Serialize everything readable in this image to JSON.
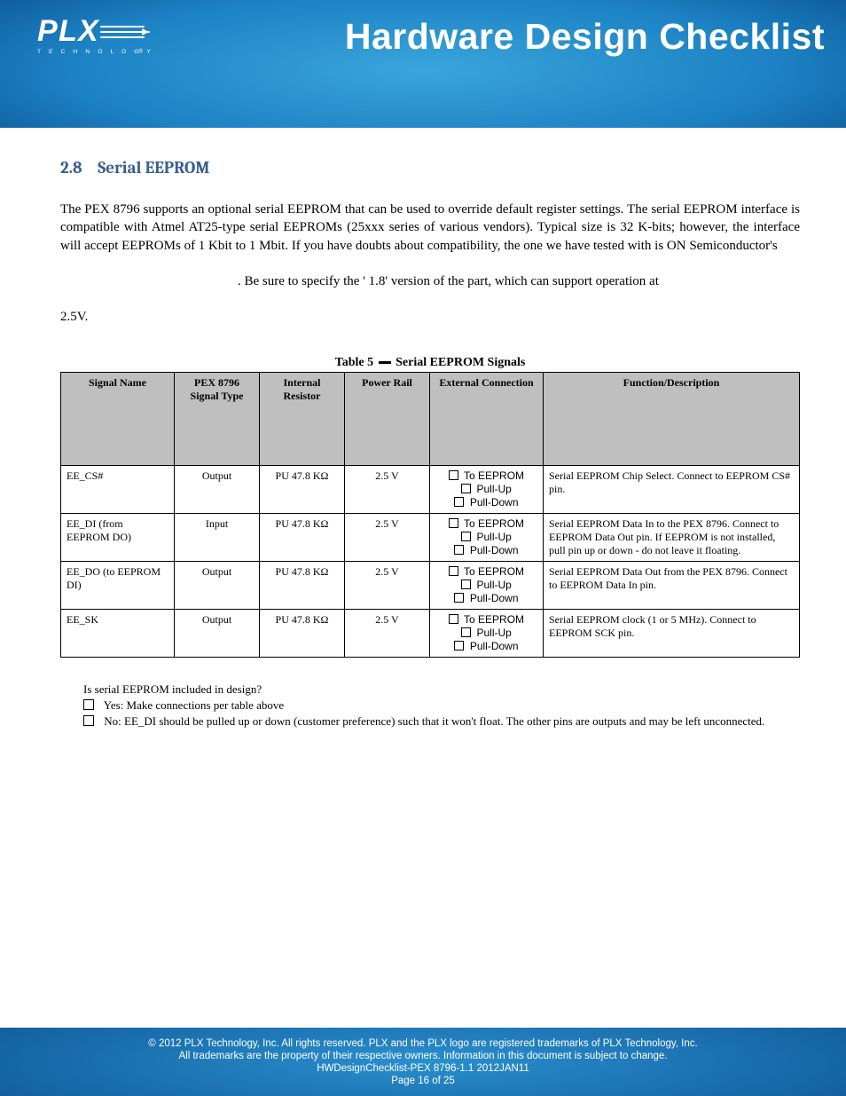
{
  "banner": {
    "title": "Hardware Design Checklist",
    "logo_alt": "PLX Technology"
  },
  "section": {
    "number": "2.8",
    "title": "Serial EEPROM"
  },
  "intro_line1": "The PEX 8796 supports an optional serial EEPROM that can be used to override default register settings. The serial EEPROM interface is compatible with Atmel AT25-type serial EEPROMs (25xxx series of various vendors). Typical size is 32 K-bits; however, the interface will accept EEPROMs of 1 Kbit to 1 Mbit. If you have doubts about compatibility, the one we have tested with is ON Semiconductor's",
  "intro_line2": ". Be sure to specify the ' 1.8' version of the part, which can support operation at",
  "intro_line3": "2.5V.",
  "table_caption_pre": "Table 5",
  "table_caption_post": "Serial EEPROM Signals",
  "columns": {
    "signal": "Signal Name",
    "type": "PEX 8796 Signal Type",
    "int": "Internal Resistor",
    "rail": "Power Rail",
    "conn": "External Connection",
    "func": "Function/Description"
  },
  "chk_options": [
    "To EEPROM",
    "Pull-Up",
    "Pull-Down"
  ],
  "rows": [
    {
      "signal": "EE_CS#",
      "type": "Output",
      "int": "PU 47.8 KΩ",
      "rail": "2.5 V",
      "func": "Serial EEPROM Chip Select. Connect to EEPROM CS# pin."
    },
    {
      "signal": "EE_DI (from EEPROM DO)",
      "type": "Input",
      "int": "PU 47.8 KΩ",
      "rail": "2.5 V",
      "func": "Serial EEPROM Data In to the PEX 8796. Connect to EEPROM Data Out pin. If EEPROM is not installed, pull pin up or down - do not leave it floating."
    },
    {
      "signal": "EE_DO (to EEPROM DI)",
      "type": "Output",
      "int": "PU 47.8 KΩ",
      "rail": "2.5 V",
      "func": "Serial EEPROM Data Out from the PEX 8796. Connect to EEPROM Data In pin."
    },
    {
      "signal": "EE_SK",
      "type": "Output",
      "int": "PU 47.8 KΩ",
      "rail": "2.5 V",
      "func": "Serial EEPROM clock (1 or 5 MHz). Connect to EEPROM SCK pin."
    }
  ],
  "post": {
    "q": "Is serial EEPROM included in design?",
    "yes": "Yes: Make connections per table above",
    "no": "No: EE_DI should be pulled up or down (customer preference) such that it won't float. The other pins are outputs and may be left unconnected."
  },
  "footer": {
    "l1": "© 2012 PLX Technology, Inc. All rights reserved. PLX and the PLX logo are registered trademarks of PLX Technology, Inc.",
    "l2": "All trademarks are the property of their respective owners. Information in this document is subject to change.",
    "l3": "HWDesignChecklist-PEX 8796-1.1     2012JAN11",
    "l4": "Page 16 of 25"
  }
}
